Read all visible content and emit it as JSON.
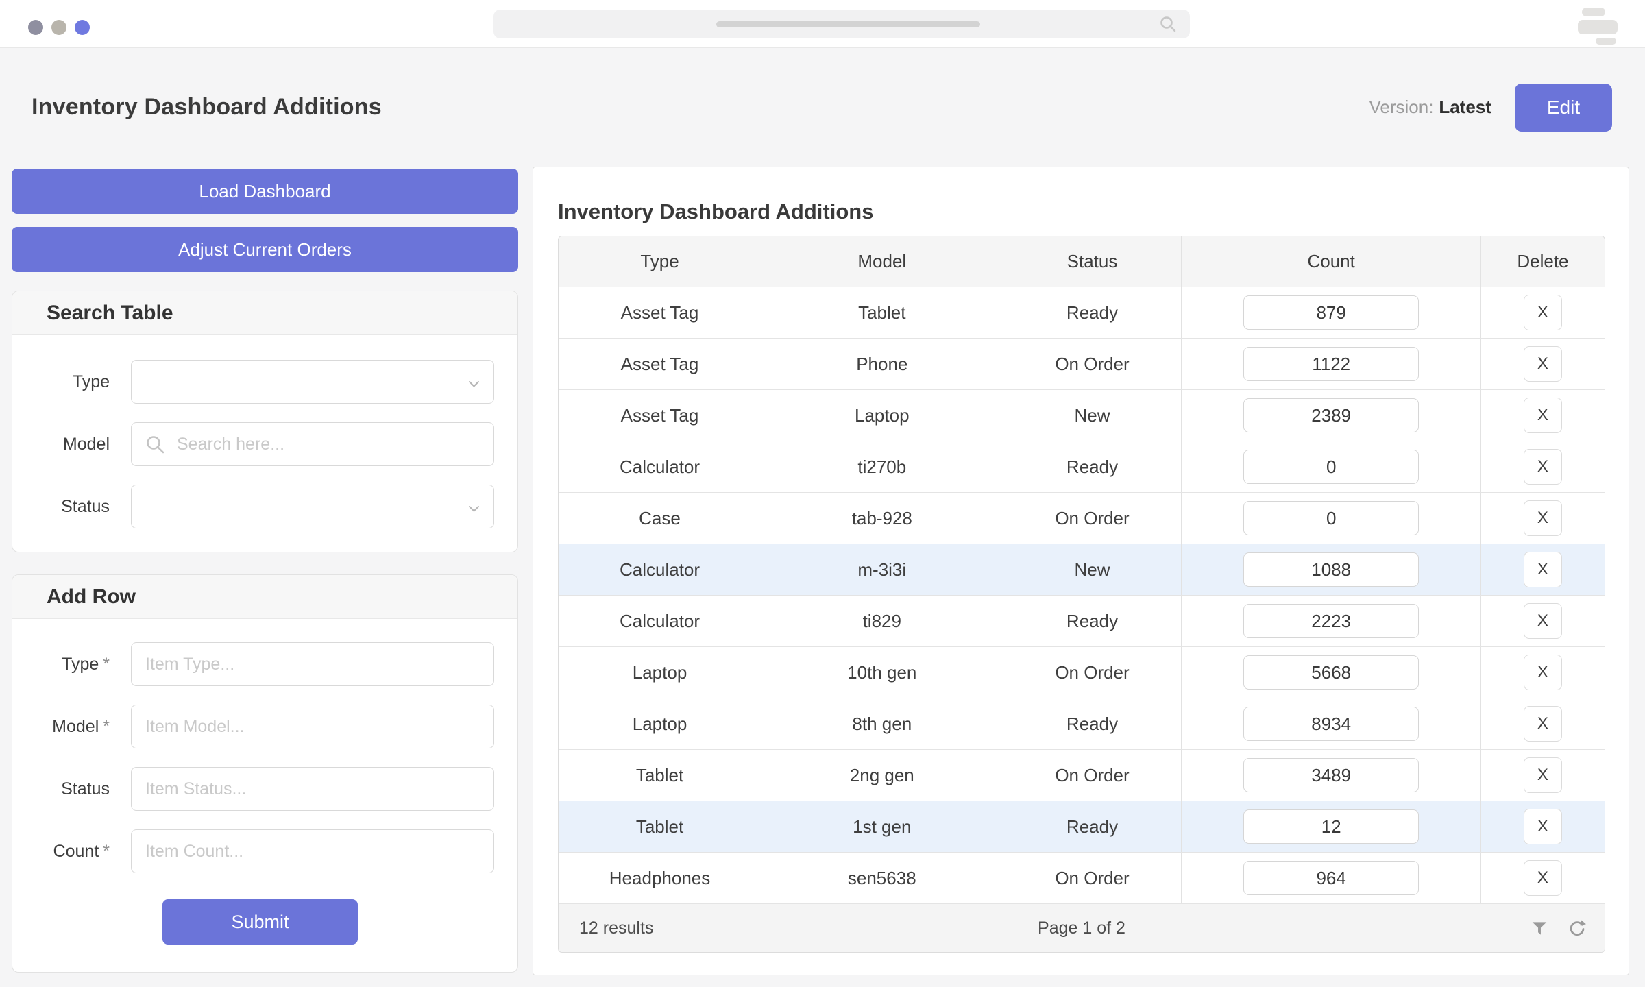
{
  "topbar": {
    "dot_colors": [
      "#8f8fa0",
      "#b9b5ac",
      "#6f79e0"
    ],
    "search": {
      "value": "",
      "placeholder": ""
    }
  },
  "header": {
    "title": "Inventory Dashboard Additions",
    "version_label": "Version:",
    "version_value": "Latest",
    "edit_button": "Edit"
  },
  "sidebar": {
    "load_button": "Load Dashboard",
    "adjust_button": "Adjust Current Orders",
    "search_panel": {
      "title": "Search Table",
      "fields": [
        {
          "label": "Type",
          "kind": "select",
          "value": ""
        },
        {
          "label": "Model",
          "kind": "search",
          "value": "",
          "placeholder": "Search here..."
        },
        {
          "label": "Status",
          "kind": "select",
          "value": ""
        }
      ]
    },
    "add_panel": {
      "title": "Add Row",
      "fields": [
        {
          "label": "Type",
          "required": true,
          "value": "",
          "placeholder": "Item Type..."
        },
        {
          "label": "Model",
          "required": true,
          "value": "",
          "placeholder": "Item Model..."
        },
        {
          "label": "Status",
          "required": false,
          "value": "",
          "placeholder": "Item Status..."
        },
        {
          "label": "Count",
          "required": true,
          "value": "",
          "placeholder": "Item Count..."
        }
      ],
      "required_marker": "*",
      "submit_button": "Submit"
    }
  },
  "main": {
    "title": "Inventory Dashboard Additions",
    "table": {
      "columns": [
        "Type",
        "Model",
        "Status",
        "Count",
        "Delete"
      ],
      "delete_label": "X",
      "rows": [
        {
          "type": "Asset Tag",
          "model": "Tablet",
          "status": "Ready",
          "count": "879",
          "highlighted": false
        },
        {
          "type": "Asset Tag",
          "model": "Phone",
          "status": "On Order",
          "count": "1122",
          "highlighted": false
        },
        {
          "type": "Asset Tag",
          "model": "Laptop",
          "status": "New",
          "count": "2389",
          "highlighted": false
        },
        {
          "type": "Calculator",
          "model": "ti270b",
          "status": "Ready",
          "count": "0",
          "highlighted": false
        },
        {
          "type": "Case",
          "model": "tab-928",
          "status": "On Order",
          "count": "0",
          "highlighted": false
        },
        {
          "type": "Calculator",
          "model": "m-3i3i",
          "status": "New",
          "count": "1088",
          "highlighted": true
        },
        {
          "type": "Calculator",
          "model": "ti829",
          "status": "Ready",
          "count": "2223",
          "highlighted": false
        },
        {
          "type": "Laptop",
          "model": "10th gen",
          "status": "On Order",
          "count": "5668",
          "highlighted": false
        },
        {
          "type": "Laptop",
          "model": "8th gen",
          "status": "Ready",
          "count": "8934",
          "highlighted": false
        },
        {
          "type": "Tablet",
          "model": "2ng gen",
          "status": "On Order",
          "count": "3489",
          "highlighted": false
        },
        {
          "type": "Tablet",
          "model": "1st gen",
          "status": "Ready",
          "count": "12",
          "highlighted": true
        },
        {
          "type": "Headphones",
          "model": "sen5638",
          "status": "On Order",
          "count": "964",
          "highlighted": false
        }
      ],
      "footer": {
        "results": "12 results",
        "page": "Page 1 of 2"
      }
    }
  },
  "colors": {
    "accent": "#6b74d9",
    "highlight_row": "#e9f1fb",
    "panel_header_bg": "#f7f7f7",
    "table_header_bg": "#f5f5f5",
    "page_bg": "#f5f5f6"
  }
}
